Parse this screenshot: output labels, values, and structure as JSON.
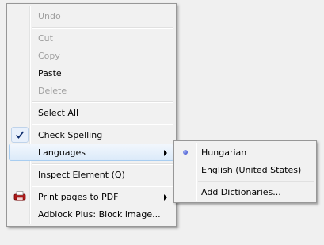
{
  "context_menu": {
    "items": {
      "undo": "Undo",
      "cut": "Cut",
      "copy": "Copy",
      "paste": "Paste",
      "delete": "Delete",
      "select_all": "Select All",
      "check_spelling": "Check Spelling",
      "languages": "Languages",
      "inspect_element": "Inspect Element (Q)",
      "print_pdf": "Print pages to PDF",
      "adblock": "Adblock Plus: Block image..."
    },
    "states": {
      "disabled": [
        "Undo",
        "Cut",
        "Copy",
        "Delete"
      ],
      "checked": "Check Spelling",
      "highlighted": "Languages"
    },
    "icons": {
      "check_spelling": "checkmark-icon",
      "print_pdf": "pdf-printer-icon",
      "submenu": "submenu-arrow-icon"
    }
  },
  "languages_submenu": {
    "items": {
      "hungarian": "Hungarian",
      "english_us": "English (United States)",
      "add_dictionaries": "Add Dictionaries..."
    },
    "selected": "Hungarian"
  },
  "colors": {
    "menu_background": "#f1f1f1",
    "menu_border": "#979797",
    "hover_border": "#a8cdf0",
    "disabled_text": "#a0a0a0",
    "radio_dot": "#2b3ec8"
  }
}
